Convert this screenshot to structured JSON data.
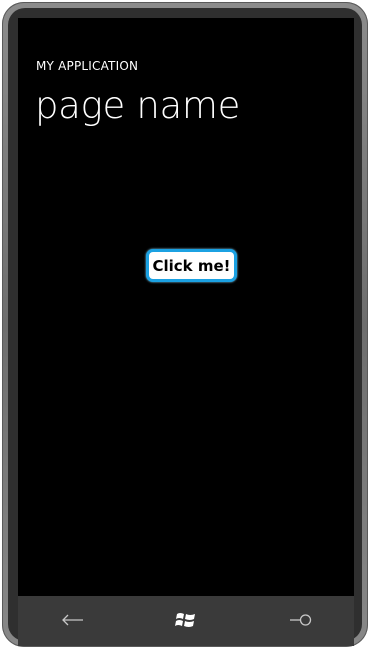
{
  "app": {
    "title": "MY APPLICATION",
    "page_name": "page name"
  },
  "main": {
    "button_label": "Click me!"
  },
  "nav": {
    "back_icon": "back-arrow-icon",
    "start_icon": "windows-logo-icon",
    "search_icon": "search-icon"
  },
  "colors": {
    "accent": "#1ba1e2",
    "screen_background": "#000000",
    "text": "#ffffff"
  }
}
